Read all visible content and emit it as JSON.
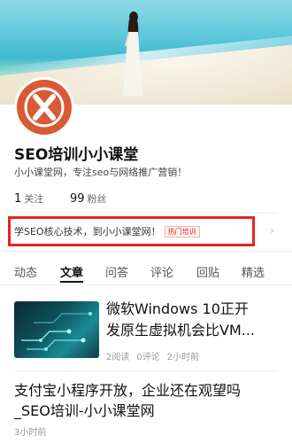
{
  "profile": {
    "name": "SEO培训小小课堂",
    "description": "小小课堂网，专注seo与网络推广营销！",
    "stats": {
      "following_count": "1",
      "following_label": "关注",
      "followers_count": "99",
      "followers_label": "粉丝"
    }
  },
  "promo": {
    "text": "学SEO核心技术，到小小课堂网！",
    "badge": "热门培训",
    "arrow": "›",
    "highlight_color": "#e8231e"
  },
  "tabs": [
    {
      "label": "动态",
      "active": false
    },
    {
      "label": "文章",
      "active": true
    },
    {
      "label": "问答",
      "active": false
    },
    {
      "label": "评论",
      "active": false
    },
    {
      "label": "回贴",
      "active": false
    },
    {
      "label": "精选",
      "active": false
    }
  ],
  "articles": [
    {
      "title_line1": "微软Windows 10正开",
      "title_line2": "发原生虚拟机会比VM...",
      "reads": "2阅读",
      "comments": "0评论",
      "time": "2小时前",
      "thumbnail_icon": "circuit-thumbnail"
    },
    {
      "title_line1": "支付宝小程序开放，企业还在观望吗",
      "title_line2": "_SEO培训-小小课堂网",
      "time": "3小时前"
    }
  ],
  "colors": {
    "avatar_bg": "#d95a36",
    "tab_active": "#111111"
  }
}
